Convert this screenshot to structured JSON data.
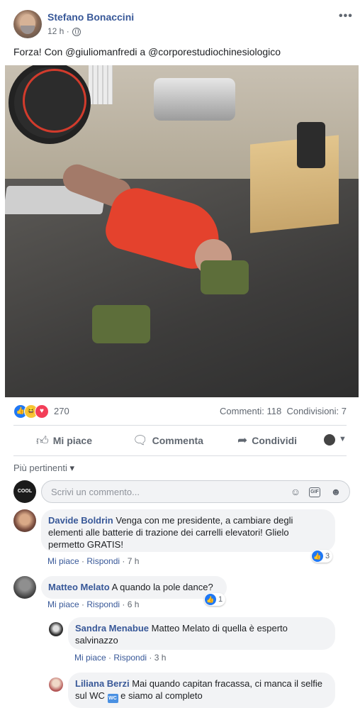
{
  "post": {
    "author": "Stefano Bonaccini",
    "time": "12 h",
    "separator": "·",
    "text": "Forza! Con @giuliomanfredi a @corporestudiochinesiologico",
    "more": "•••"
  },
  "reactions": {
    "count": "270",
    "icons": [
      "like-icon",
      "haha-icon",
      "love-icon"
    ],
    "comments": "Commenti: 118",
    "shares": "Condivisioni: 7"
  },
  "actions": {
    "like": "Mi piace",
    "comment": "Commenta",
    "share": "Condividi"
  },
  "comments_section": {
    "filter": "Più pertinenti",
    "filter_caret": "▾",
    "input_placeholder": "Scrivi un commento...",
    "avatar_label": "COOL CONNECTION"
  },
  "comments": [
    {
      "name": "Davide Boldrin",
      "text": "Venga con me presidente, a cambiare degli elementi alle batterie di trazione dei carrelli elevatori! Glielo permetto GRATIS!",
      "like": "Mi piace",
      "reply": "Rispondi",
      "time": "7 h",
      "reactions": "3"
    },
    {
      "name": "Matteo Melato",
      "text": "A quando la pole dance?",
      "like": "Mi piace",
      "reply": "Rispondi",
      "time": "6 h",
      "reactions": "1"
    },
    {
      "name": "Sandra Menabue",
      "text": "Matteo Melato di quella è esperto salvinazzo",
      "like": "Mi piace",
      "reply": "Rispondi",
      "time": "3 h"
    },
    {
      "name": "Liliana Berzi",
      "text_before": "Mai quando capitan fracassa, ci manca il selfie sul WC",
      "emoji": "WC",
      "text_after": "e siamo al completo"
    }
  ],
  "colors": {
    "link": "#385898",
    "like_blue": "#2078f4",
    "text": "#1c1e21",
    "muted": "#606770",
    "bubble": "#f2f3f5"
  }
}
